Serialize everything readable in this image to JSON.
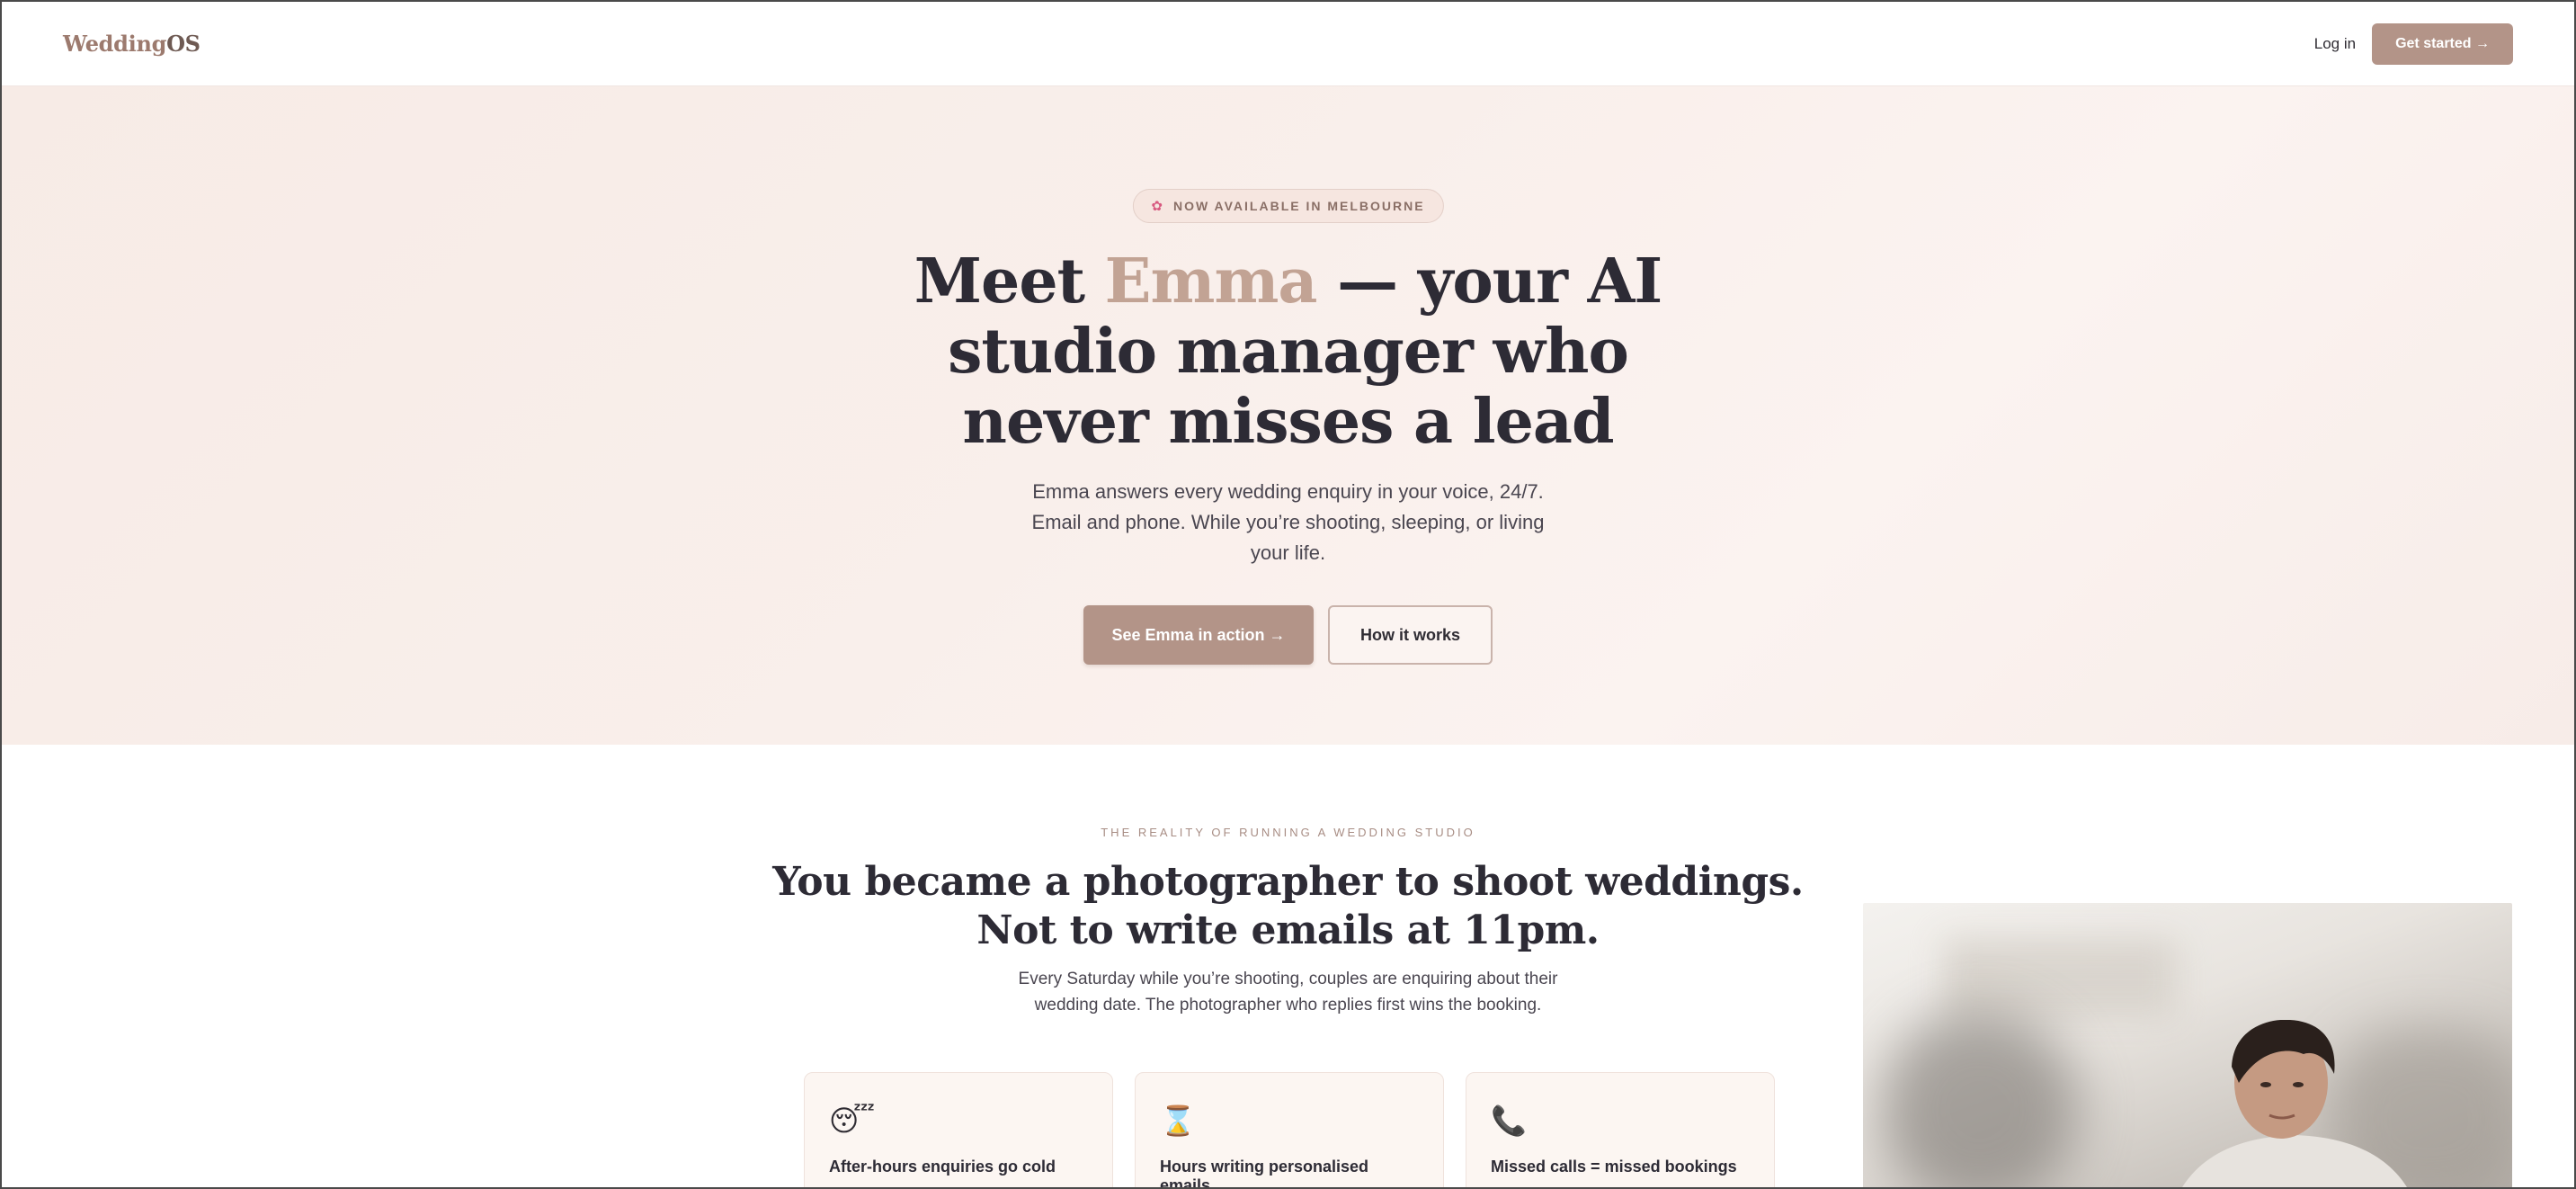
{
  "brand": {
    "name_main": "Wedding",
    "name_suffix": "OS"
  },
  "nav": {
    "login_label": "Log in",
    "cta_label": "Get started →"
  },
  "hero": {
    "badge_text": "NOW AVAILABLE IN MELBOURNE",
    "title_prefix": "Meet ",
    "title_accent": "Emma",
    "title_rest_line1": " — your AI",
    "title_line2": "studio manager who",
    "title_line3": "never misses a lead",
    "subtitle": "Emma answers every wedding enquiry in your voice, 24/7. Email and phone. While you’re shooting, sleeping, or living your life.",
    "primary_cta": "See Emma in action →",
    "secondary_cta": "How it works"
  },
  "problem": {
    "eyebrow": "THE REALITY OF RUNNING A WEDDING STUDIO",
    "title_line1": "You became a photographer to shoot weddings.",
    "title_line2": "Not to write emails at 11pm.",
    "subtitle": "Every Saturday while you’re shooting, couples are enquiring about their wedding date. The photographer who replies first wins the booking.",
    "cards": [
      {
        "icon": "sleeping-face-icon",
        "glyph": "😴",
        "title": "After-hours enquiries go cold"
      },
      {
        "icon": "hourglass-icon",
        "glyph": "⌛",
        "title": "Hours writing personalised emails"
      },
      {
        "icon": "phone-icon",
        "glyph": "📞",
        "title": "Missed calls = missed bookings"
      }
    ]
  },
  "colors": {
    "accent": "#b39488",
    "accent_text": "#c2a394",
    "heading": "#2d2b35",
    "hero_bg": "#f8ede9",
    "badge_dot": "#d85a80"
  }
}
